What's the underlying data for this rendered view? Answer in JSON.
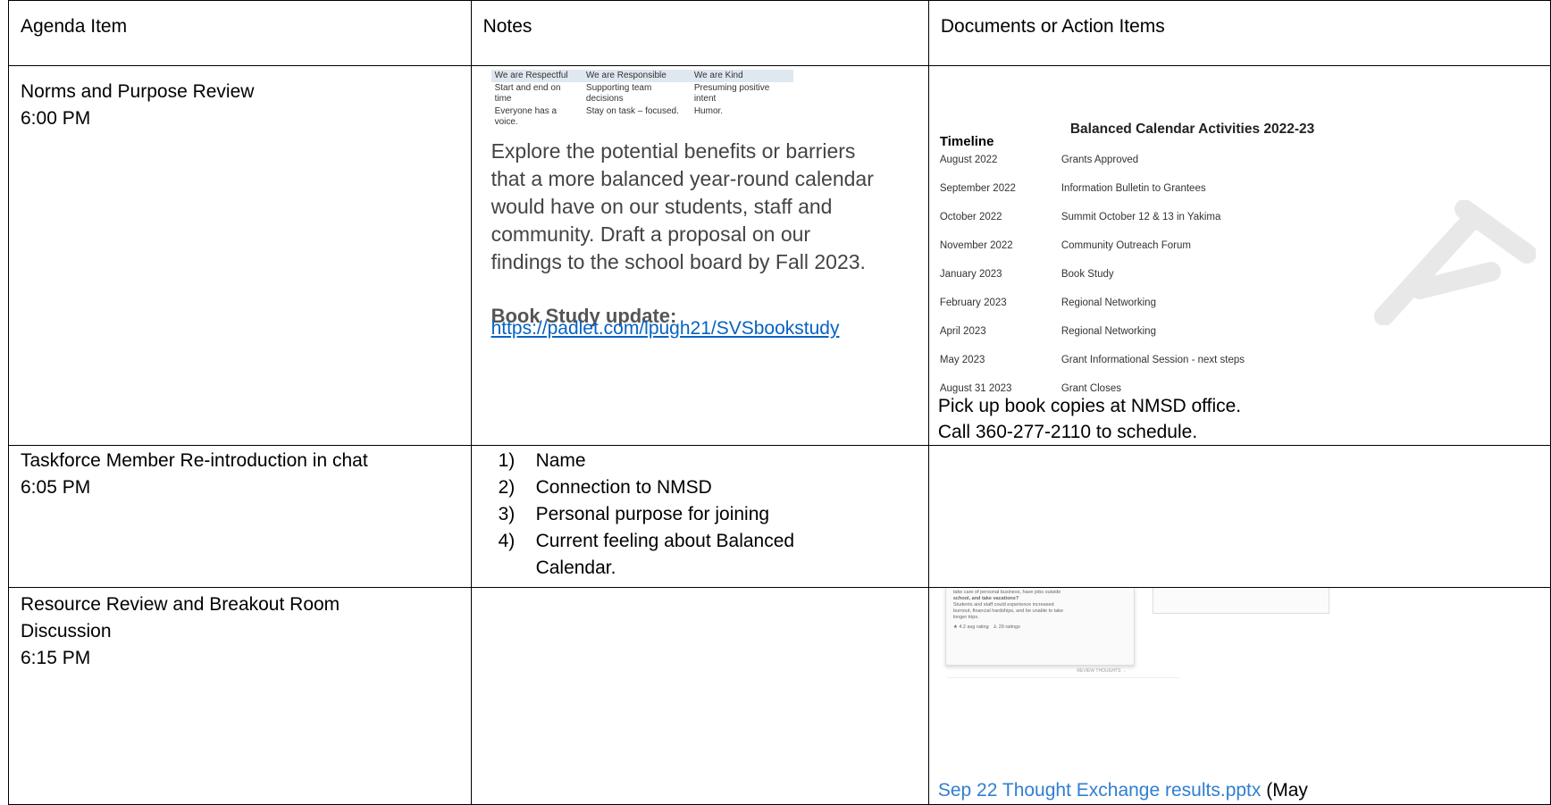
{
  "headers": {
    "agenda": "Agenda Item",
    "notes": "Notes",
    "documents": "Documents or Action Items"
  },
  "row1": {
    "agenda_title": "Norms and Purpose Review",
    "agenda_time": "6:00 PM",
    "norms": {
      "headers": [
        "We are Respectful",
        "We are Responsible",
        "We are Kind"
      ],
      "row1": [
        "Start and end on time",
        "Supporting team decisions",
        "Presuming positive intent"
      ],
      "row2": [
        "Everyone has a voice.",
        "Stay on task – focused.",
        "Humor."
      ]
    },
    "purpose": "Explore the potential benefits or barriers that a more balanced year-round calendar would have on our students, staff and community. Draft a proposal on our findings to the school board by Fall 2023.",
    "book_title": "Book Study update:",
    "book_link": "https://padlet.com/lpugh21/SVSbookstudy",
    "timeline": {
      "title": "Balanced Calendar Activities 2022-23",
      "heading": "Timeline",
      "items": [
        {
          "date": "August 2022",
          "activity": "Grants Approved"
        },
        {
          "date": "September 2022",
          "activity": "Information Bulletin to Grantees"
        },
        {
          "date": "October 2022",
          "activity": "Summit October 12 & 13 in Yakima"
        },
        {
          "date": "November 2022",
          "activity": "Community Outreach Forum"
        },
        {
          "date": "January 2023",
          "activity": "Book Study"
        },
        {
          "date": "February 2023",
          "activity": "Regional Networking"
        },
        {
          "date": "April 2023",
          "activity": "Regional Networking"
        },
        {
          "date": "May 2023",
          "activity": "Grant Informational Session - next steps"
        },
        {
          "date": "August 31 2023",
          "activity": "Grant Closes"
        }
      ]
    },
    "pickup_line1": "Pick up book copies at NMSD office.",
    "pickup_line2": "Call 360-277-2110 to schedule."
  },
  "row2": {
    "agenda_title": "Taskforce Member Re-introduction in chat",
    "agenda_time": "6:05 PM",
    "steps": [
      {
        "num": "1)",
        "text": "Name"
      },
      {
        "num": "2)",
        "text": "Connection to NMSD"
      },
      {
        "num": "3)",
        "text": "Personal purpose for joining"
      },
      {
        "num": "4)",
        "text": "Current feeling about Balanced Calendar."
      }
    ]
  },
  "row3": {
    "agenda_title_1": "Resource Review and Breakout Room",
    "agenda_title_2": "Discussion",
    "agenda_time": "6:15 PM",
    "thumb": {
      "line1": "take care of personal business, have jobs outside",
      "line2": "school, and take vacations?",
      "line3": "Students and staff could experience increased",
      "line4": "burnout, financial hardships, and be unable to take",
      "line5": "longer trips.",
      "rating": "★ 4.2 avg rating",
      "ratings_count": "♙ 29 ratings",
      "review": "REVIEW THOUGHTS →"
    },
    "result_link": "Sep 22 Thought Exchange results.pptx",
    "result_suffix": " (May"
  }
}
